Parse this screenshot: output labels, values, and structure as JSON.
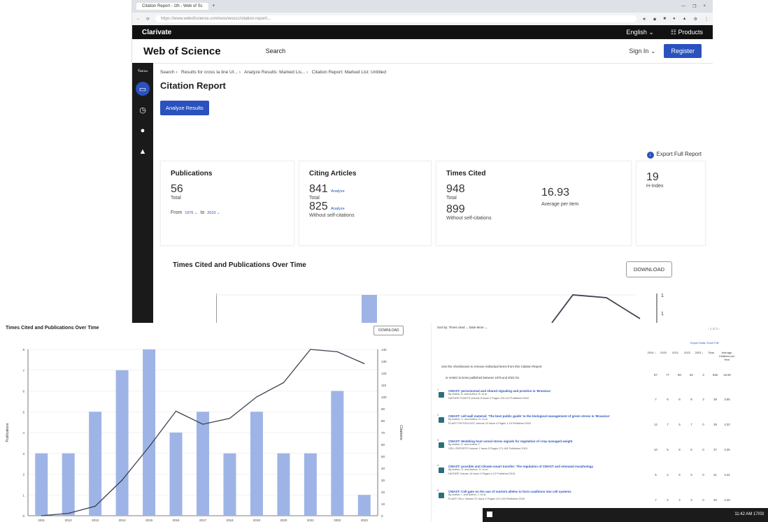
{
  "browser": {
    "tab_title": "Citation Report - 1th - Web of Sc",
    "new_tab": "+",
    "window_controls": [
      "—",
      "❐",
      "×"
    ],
    "url": "https://www.webofscience.com/wos/woscc/citation-report/...",
    "extension_icons": [
      "★",
      "◆",
      "■",
      "●",
      "▲",
      "⚙",
      "⋮"
    ]
  },
  "clarivate": {
    "brand": "Clarivate",
    "language": "English ⌄",
    "products": "Products"
  },
  "wos": {
    "logo": "Web of Science",
    "search": "Search",
    "sign_in": "Sign In ⌄",
    "register": "Register"
  },
  "sidebar": {
    "expand": "MENU",
    "icons": [
      "folder-icon",
      "history-icon",
      "user-icon",
      "bell-icon"
    ]
  },
  "breadcrumb": [
    "Search ›",
    "Results for cross la line UI... ›",
    "Analyze Results: Marked Lis... ›",
    "Citation Report: Marked List: Untitled"
  ],
  "page_title": "Citation Report",
  "analyze_button": "Analyze Results",
  "export_full_report": "Export Full Report",
  "metrics": {
    "publications": {
      "label": "Publications",
      "total": "56",
      "total_label": "Total",
      "from_label": "From",
      "from": "1976 ⌄",
      "to_label": "to",
      "to": "2023 ⌄"
    },
    "citing_articles": {
      "label": "Citing Articles",
      "total": "841",
      "analyze": "Analyze",
      "total_label": "Total",
      "without_self": "825",
      "analyze2": "Analyze",
      "without_self_label": "Without self-citations"
    },
    "times_cited": {
      "label": "Times Cited",
      "total": "948",
      "total_label": "Total",
      "average": "16.93",
      "average_label": "Average per item",
      "without_self": "899",
      "without_self_label": "Without self-citations"
    },
    "h_index": {
      "value": "19",
      "label": "H-Index"
    }
  },
  "chart_section": {
    "title": "Times Cited and Publications Over Time",
    "download": "DOWNLOAD"
  },
  "top_chart_axis": {
    "left_ticks": [
      "8"
    ],
    "right_ticks": [
      "140",
      "130"
    ]
  },
  "printed_chart": {
    "title": "Times Cited and Publications Over Time",
    "download": "DOWNLOAD"
  },
  "chart_data": {
    "type": "bar",
    "title": "Times Cited and Publications Over Time",
    "categories": [
      "2011",
      "2012",
      "2013",
      "2014",
      "2015",
      "2016",
      "2017",
      "2018",
      "2019",
      "2020",
      "2021",
      "2022",
      "2023"
    ],
    "series": [
      {
        "name": "Publications",
        "type": "bar",
        "values": [
          3,
          3,
          5,
          7,
          8,
          4,
          5,
          3,
          5,
          3,
          3,
          6,
          1
        ],
        "axis": "left"
      },
      {
        "name": "Citations",
        "type": "line",
        "values": [
          0,
          2,
          8,
          30,
          58,
          88,
          77,
          82,
          100,
          112,
          140,
          138,
          128
        ],
        "axis": "right"
      }
    ],
    "ylabel": "Publications",
    "y2label": "Citations",
    "ylim": [
      0,
      8
    ],
    "y2lim": [
      0,
      140
    ],
    "yticks": [
      0,
      1,
      2,
      3,
      4,
      5,
      6,
      7,
      8
    ],
    "y2ticks": [
      0,
      10,
      20,
      30,
      40,
      50,
      60,
      70,
      80,
      90,
      100,
      110,
      120,
      130,
      140
    ],
    "grid": true,
    "colors": {
      "bar": "#9fb4e6",
      "line": "#3b4150"
    }
  },
  "results_panel": {
    "sort": "Sort by: Times cited ⌄   Date   More ⌄",
    "pagination": "‹  1  of 3  ›",
    "export_link": "Export Data: Excel File",
    "year_headers": [
      "2019 ↓",
      "2020",
      "2021",
      "2022",
      "2023 ↓",
      "Total",
      "Average Citations per Year"
    ],
    "summary_label": "Use the checkboxes to remove individual items from this Citation Report",
    "summary_values": [
      "87",
      "77",
      "80",
      "82",
      "3",
      "948",
      "16.93"
    ],
    "year_select": "or restrict to items published between  1976  and  2023  Go",
    "items": [
      {
        "num": "1",
        "title": "CMAST: peroxisomal and shared signaling and proteins in 'Brassica'",
        "authors": "By Author, A. and Author, B. et al.",
        "journal": "NATURE PLANTS Volume 8 Issue 2 Pages 100-110 Published 2022",
        "nums": [
          "7",
          "6",
          "6",
          "8",
          "3",
          "39",
          "3.55"
        ]
      },
      {
        "num": "2",
        "title": "CMAST: cell wall material: 'The best public guide' to the biological management of green stress in 'Brassica'",
        "authors": "By Author, C. and Author, D. et al.",
        "journal": "PLANT PHYSIOLOGY Volume 12 Issue 4 Pages 1-15 Published 2020",
        "nums": [
          "12",
          "7",
          "5",
          "7",
          "0",
          "39",
          "4.33"
        ]
      },
      {
        "num": "3",
        "title": "CMAST: Modeling host cereal stress signals for regulation of crop managed weight",
        "authors": "By Author, E. and Author, F.",
        "journal": "CELL REPORTS Volume 2 Issue 5 Pages 171-181 Published 2019",
        "nums": [
          "10",
          "5",
          "8",
          "6",
          "0",
          "37",
          "3.36"
        ]
      },
      {
        "num": "4",
        "title": "CMAST: possible and climate-smart transfer: The regulation of CMAST and stomatal morphology",
        "authors": "By Author, G. and Author, H. et al.",
        "journal": "NATURE Volume 14 Issue 4 Pages 4-12 Published 2016",
        "nums": [
          "5",
          "4",
          "6",
          "5",
          "0",
          "31",
          "3.44"
        ]
      },
      {
        "num": "5",
        "title": "CMAST: Cell gate on the use of nutrient alleles to form coalitions into cell systems",
        "authors": "By Author, I. and Author, J. et al.",
        "journal": "PLANT CELL Volume 21 Issue 2 Pages 121-130 Published 2018",
        "nums": [
          "7",
          "4",
          "4",
          "3",
          "0",
          "30",
          "4.29"
        ]
      }
    ]
  },
  "taskbar": {
    "clock": "11:42 AM  17/03"
  }
}
